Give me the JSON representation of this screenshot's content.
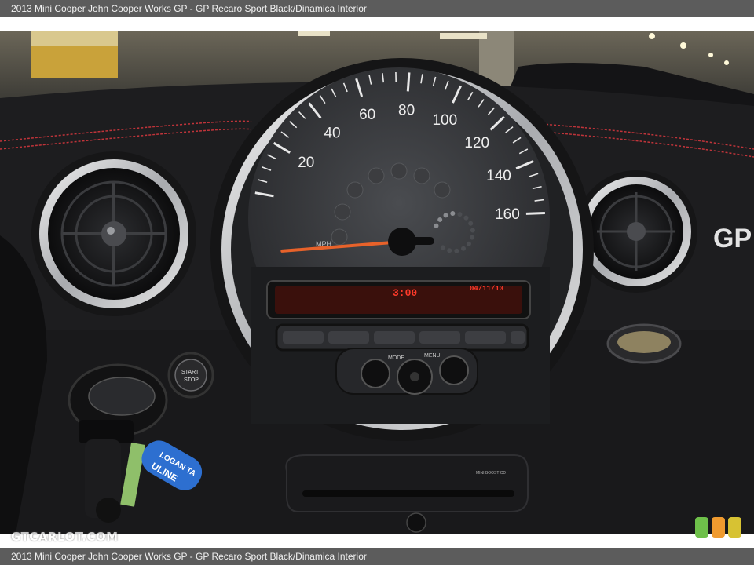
{
  "caption": {
    "top": "2013 Mini Cooper John Cooper Works GP - GP Recaro Sport Black/Dinamica Interior",
    "bottom": "2013 Mini Cooper John Cooper Works GP - GP Recaro Sport Black/Dinamica Interior"
  },
  "watermark": "GTCARLOT.COM",
  "speedometer": {
    "unit": "MPH",
    "labels": [
      "20",
      "40",
      "60",
      "80",
      "100",
      "120",
      "140",
      "160"
    ],
    "needle_value_mph": 0
  },
  "display": {
    "time": "3:00",
    "date": "04/11/13"
  },
  "controls": {
    "mode_label": "MODE",
    "menu_label": "MENU",
    "start_stop_line1": "START",
    "start_stop_line2": "STOP",
    "cd_label": "MINI BOOST CD"
  },
  "dash_text": "GP",
  "key_tag": "LOGAN TA",
  "key_tag_line2": "ULINE",
  "colors": {
    "stitching": "#c0343a",
    "needle": "#e8622a",
    "display_text": "#ff3a2a",
    "key_tag": "#2d6fd0"
  }
}
